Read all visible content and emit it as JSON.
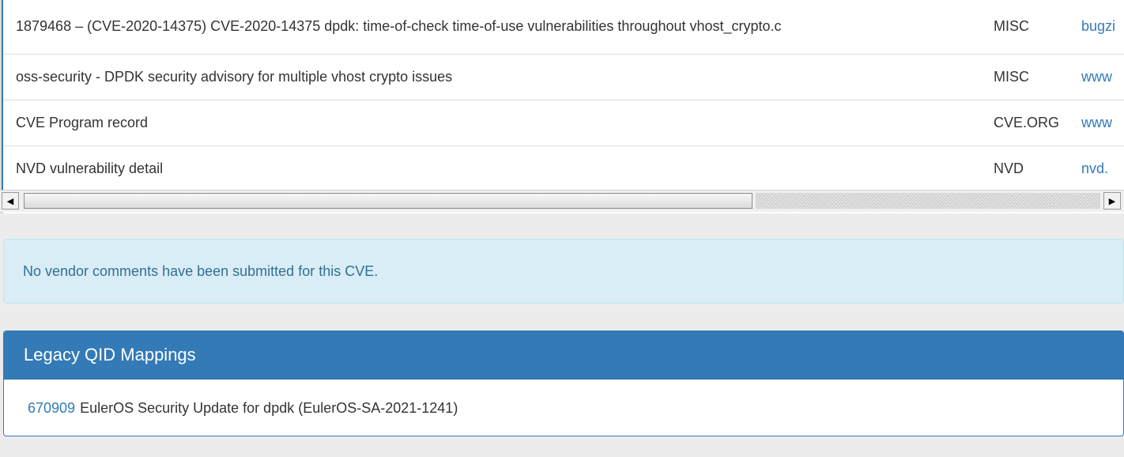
{
  "references": {
    "rows": [
      {
        "description": "1879468 – (CVE-2020-14375) CVE-2020-14375 dpdk: time-of-check time-of-use vulnerabilities throughout vhost_crypto.c",
        "source": "MISC",
        "url": "bugzi"
      },
      {
        "description": "oss-security - DPDK security advisory for multiple vhost crypto issues",
        "source": "MISC",
        "url": "www"
      },
      {
        "description": "CVE Program record",
        "source": "CVE.ORG",
        "url": "www"
      },
      {
        "description": "NVD vulnerability detail",
        "source": "NVD",
        "url": "nvd."
      }
    ],
    "scroll_left_icon": "◀",
    "scroll_right_icon": "▶"
  },
  "vendor_comments": {
    "message": "No vendor comments have been submitted for this CVE."
  },
  "legacy_qid": {
    "title": "Legacy QID Mappings",
    "items": [
      {
        "qid": "670909",
        "text": "EulerOS Security Update for dpdk (EulerOS-SA-2021-1241)"
      }
    ]
  },
  "colors": {
    "link": "#337ab7",
    "panel_header": "#337ab7",
    "alert_bg": "#d9edf7",
    "alert_text": "#31708f"
  }
}
